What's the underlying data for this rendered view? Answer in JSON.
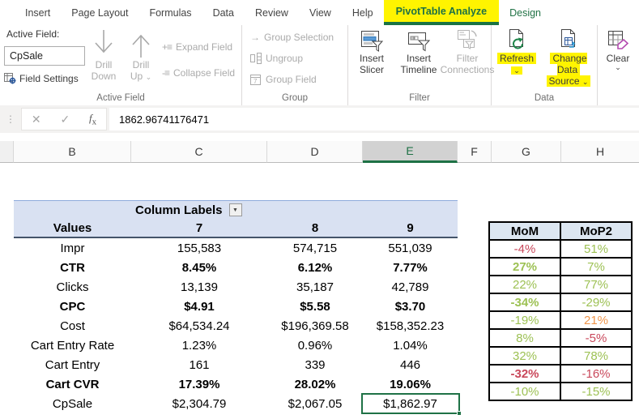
{
  "colors": {
    "green": "#9DC154",
    "red": "#C9485B",
    "orange": "#F0964B",
    "accent_green": "#1E7145",
    "highlight_yellow": "#FFF400",
    "pivot_header_fill": "#D9E1F2",
    "pivot_header_border": "#44546A",
    "delta_header_fill": "#DCE6F1",
    "selection_green": "#1F7246"
  },
  "icons": {
    "chevron_down": "⌄",
    "dropdown_arrow": "▼",
    "arrow_right": "→",
    "cancel": "✕",
    "enter": "✓",
    "fx": "fx",
    "expand_glyph": "+≡",
    "collapse_glyph": "-≡",
    "drag_dots": "⋮"
  },
  "ribbon": {
    "tabs": [
      {
        "label": "Insert"
      },
      {
        "label": "Page Layout"
      },
      {
        "label": "Formulas"
      },
      {
        "label": "Data"
      },
      {
        "label": "Review"
      },
      {
        "label": "View"
      },
      {
        "label": "Help"
      },
      {
        "label": "PivotTable Analyze"
      },
      {
        "label": "Design"
      }
    ],
    "active_field_group": {
      "label": "Active Field:",
      "value": "CpSale",
      "field_settings": "Field Settings",
      "drill_down_l1": "Drill",
      "drill_down_l2": "Down",
      "drill_up_l1": "Drill",
      "drill_up_l2": "Up",
      "expand_field": "Expand Field",
      "collapse_field": "Collapse Field",
      "group_label": "Active Field"
    },
    "group_group": {
      "group_selection": "Group Selection",
      "ungroup": "Ungroup",
      "group_field": "Group Field",
      "group_label": "Group"
    },
    "filter_group": {
      "insert_slicer_l1": "Insert",
      "insert_slicer_l2": "Slicer",
      "insert_timeline_l1": "Insert",
      "insert_timeline_l2": "Timeline",
      "filter_connections_l1": "Filter",
      "filter_connections_l2": "Connections",
      "group_label": "Filter"
    },
    "data_group": {
      "refresh": "Refresh",
      "change_data_l1": "Change Data",
      "change_data_l2": "Source",
      "group_label": "Data"
    },
    "clear_group": {
      "clear": "Clear"
    }
  },
  "formula_bar": {
    "value": "1862.96741176471"
  },
  "column_headers": {
    "letters": [
      "B",
      "C",
      "D",
      "E",
      "F",
      "G",
      "H"
    ],
    "selected": "E"
  },
  "pivot_table": {
    "column_labels_header": "Column Labels",
    "values_header": "Values",
    "column_keys": [
      "7",
      "8",
      "9"
    ],
    "rows": [
      {
        "label": "Impr",
        "bold": false,
        "values": [
          "155,583",
          "574,715",
          "551,039"
        ]
      },
      {
        "label": "CTR",
        "bold": true,
        "values": [
          "8.45%",
          "6.12%",
          "7.77%"
        ]
      },
      {
        "label": "Clicks",
        "bold": false,
        "values": [
          "13,139",
          "35,187",
          "42,789"
        ]
      },
      {
        "label": "CPC",
        "bold": true,
        "values": [
          "$4.91",
          "$5.58",
          "$3.70"
        ]
      },
      {
        "label": "Cost",
        "bold": false,
        "values": [
          "$64,534.24",
          "$196,369.58",
          "$158,352.23"
        ]
      },
      {
        "label": "Cart Entry Rate",
        "bold": false,
        "values": [
          "1.23%",
          "0.96%",
          "1.04%"
        ]
      },
      {
        "label": "Cart Entry",
        "bold": false,
        "values": [
          "161",
          "339",
          "446"
        ]
      },
      {
        "label": "Cart CVR",
        "bold": true,
        "values": [
          "17.39%",
          "28.02%",
          "19.06%"
        ]
      },
      {
        "label": "CpSale",
        "bold": false,
        "values": [
          "$2,304.79",
          "$2,067.05",
          "$1,862.97"
        ]
      }
    ],
    "selected_cell": {
      "row": "CpSale",
      "column": "9",
      "value": "$1,862.97"
    }
  },
  "delta_table": {
    "headers": [
      "MoM",
      "MoP2"
    ],
    "rows": [
      {
        "mom": "-4%",
        "mom_color": "red",
        "mom_bold": false,
        "mop2": "51%",
        "mop2_color": "green"
      },
      {
        "mom": "27%",
        "mom_color": "green",
        "mom_bold": true,
        "mop2": "7%",
        "mop2_color": "green"
      },
      {
        "mom": "22%",
        "mom_color": "green",
        "mom_bold": false,
        "mop2": "77%",
        "mop2_color": "green"
      },
      {
        "mom": "-34%",
        "mom_color": "green",
        "mom_bold": true,
        "mop2": "-29%",
        "mop2_color": "green"
      },
      {
        "mom": "-19%",
        "mom_color": "green",
        "mom_bold": false,
        "mop2": "21%",
        "mop2_color": "orange"
      },
      {
        "mom": "8%",
        "mom_color": "green",
        "mom_bold": false,
        "mop2": "-5%",
        "mop2_color": "red"
      },
      {
        "mom": "32%",
        "mom_color": "green",
        "mom_bold": false,
        "mop2": "78%",
        "mop2_color": "green"
      },
      {
        "mom": "-32%",
        "mom_color": "red",
        "mom_bold": true,
        "mop2": "-16%",
        "mop2_color": "red"
      },
      {
        "mom": "-10%",
        "mom_color": "green",
        "mom_bold": false,
        "mop2": "-15%",
        "mop2_color": "green"
      }
    ]
  }
}
